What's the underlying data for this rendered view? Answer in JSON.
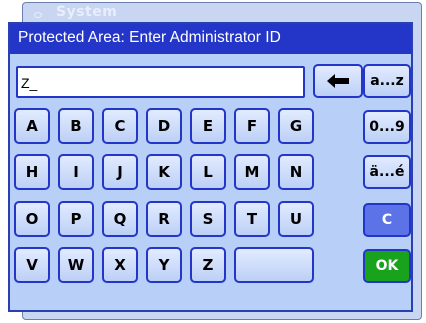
{
  "background": {
    "title": "System"
  },
  "dialog": {
    "title": "Protected Area: Enter Administrator ID",
    "input_value": "Z_"
  },
  "keys": {
    "row1": [
      "A",
      "B",
      "C",
      "D",
      "E",
      "F",
      "G"
    ],
    "row2": [
      "H",
      "I",
      "J",
      "K",
      "L",
      "M",
      "N"
    ],
    "row3": [
      "O",
      "P",
      "Q",
      "R",
      "S",
      "T",
      "U"
    ],
    "row4": [
      "V",
      "W",
      "X",
      "Y",
      "Z"
    ]
  },
  "side_buttons": {
    "lowercase": "a...z",
    "digits": "0...9",
    "accented": "ä...é",
    "clear": "C",
    "ok": "OK"
  },
  "icons": {
    "backspace": "left-arrow"
  },
  "colors": {
    "header": "#2436c8",
    "dialog_bg": "#b8cff7",
    "ok": "#19a31c",
    "clear": "#5b73e6"
  }
}
